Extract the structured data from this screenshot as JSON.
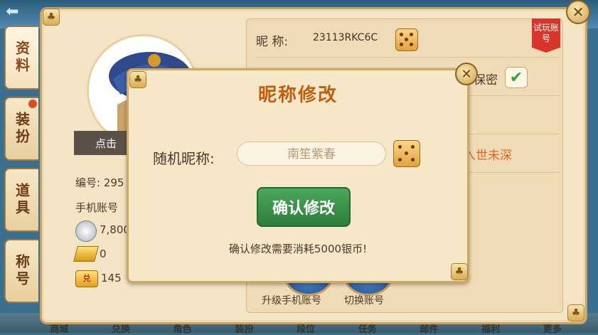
{
  "nav": {
    "side_tabs": [
      "资料",
      "装扮",
      "道具",
      "称号"
    ],
    "bottom_tabs": [
      "商城",
      "兑换",
      "角色",
      "装扮",
      "段位",
      "任务",
      "邮件",
      "福利",
      "更多"
    ]
  },
  "profile": {
    "avatar_banner": "点击",
    "id_line": "编号: 295",
    "phone_line": "手机账号",
    "silver": "7,800",
    "gold": "0",
    "coupon": "145"
  },
  "details": {
    "nick_label": "昵 称:",
    "nick_value": "23113RKC6C",
    "trial_badge": "试玩账号",
    "secret_label": "保密",
    "motto": "入世未深",
    "upgrade_label": "升级手机账号",
    "switch_label": "切换账号"
  },
  "modal": {
    "title": "昵称修改",
    "random_label": "随机昵称:",
    "random_name": "南笙紫春",
    "confirm_label": "确认修改",
    "cost_note": "确认修改需要消耗5000银币!"
  },
  "colors": {
    "accent": "#c25d0e",
    "confirm": "#3a9a4c",
    "motto": "#e2641e",
    "badge": "#d8352a"
  }
}
